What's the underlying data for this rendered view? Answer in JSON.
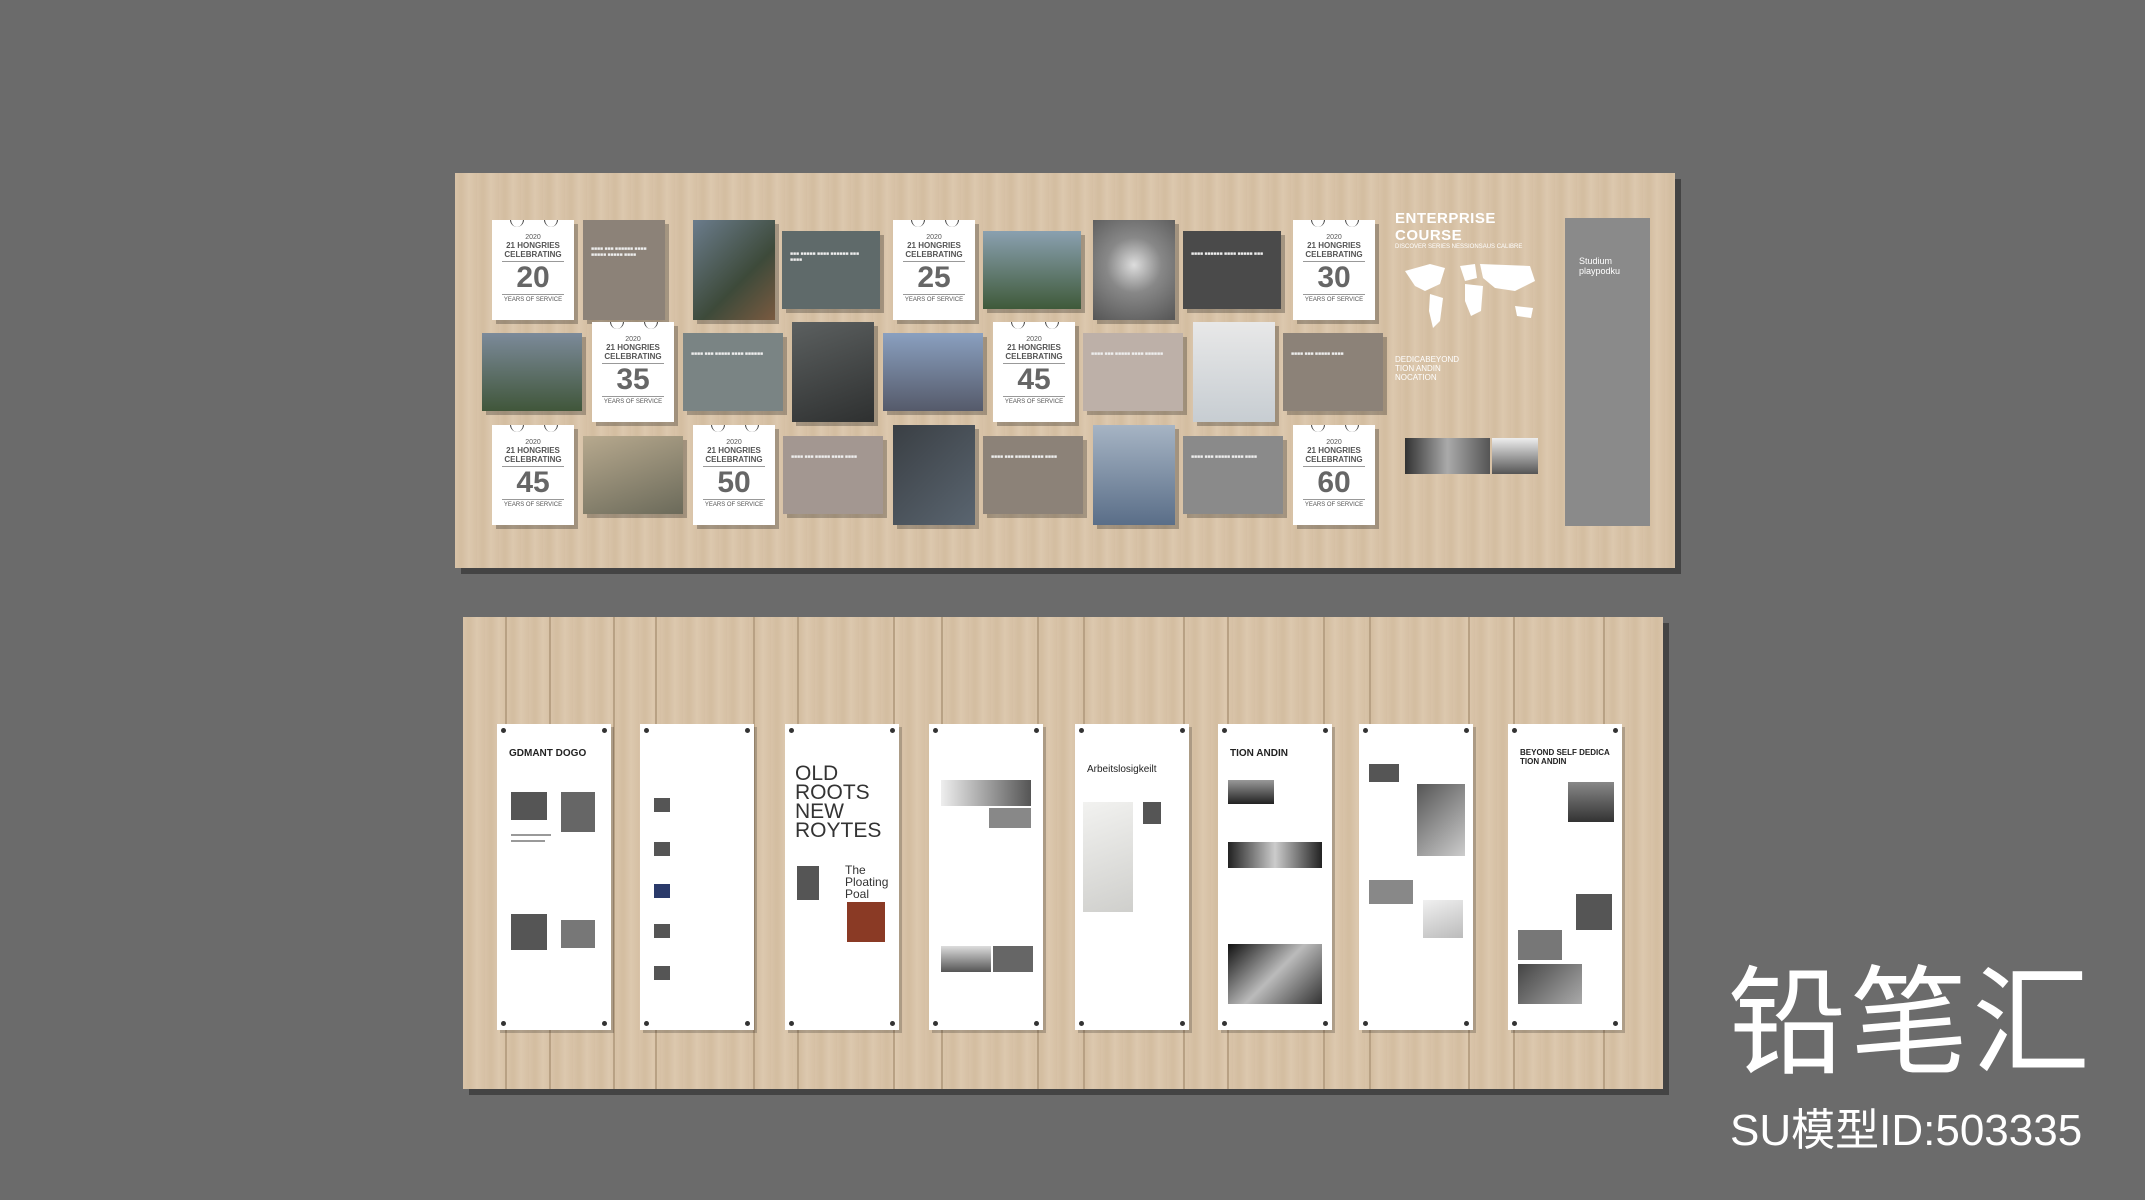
{
  "calendar_cards": [
    {
      "year": "2020",
      "line1": "21 HONGRIES",
      "line2": "CELEBRATING",
      "number": "20",
      "footer": "YEARS OF SERVICE"
    },
    {
      "year": "2020",
      "line1": "21 HONGRIES",
      "line2": "CELEBRATING",
      "number": "25",
      "footer": "YEARS OF SERVICE"
    },
    {
      "year": "2020",
      "line1": "21 HONGRIES",
      "line2": "CELEBRATING",
      "number": "30",
      "footer": "YEARS OF SERVICE"
    },
    {
      "year": "2020",
      "line1": "21 HONGRIES",
      "line2": "CELEBRATING",
      "number": "35",
      "footer": "YEARS OF SERVICE"
    },
    {
      "year": "2020",
      "line1": "21 HONGRIES",
      "line2": "CELEBRATING",
      "number": "45",
      "footer": "YEARS OF SERVICE"
    },
    {
      "year": "2020",
      "line1": "21 HONGRIES",
      "line2": "CELEBRATING",
      "number": "45",
      "footer": "YEARS OF SERVICE"
    },
    {
      "year": "2020",
      "line1": "21 HONGRIES",
      "line2": "CELEBRATING",
      "number": "50",
      "footer": "YEARS OF SERVICE"
    },
    {
      "year": "2020",
      "line1": "21 HONGRIES",
      "line2": "CELEBRATING",
      "number": "60",
      "footer": "YEARS OF SERVICE"
    }
  ],
  "map_panel": {
    "title": "ENTERPRISE COURSE",
    "subtitle": "DISCOVER SERIES NESSIONSAUS CALIBRE",
    "tagline_1": "DEDICABEYOND",
    "tagline_2": "TION ANDIN",
    "tagline_3": "NOCATION"
  },
  "side_panel": {
    "line1": "Studium",
    "line2": "playpodku"
  },
  "banners": {
    "b1_title": "GDMANT DOGO",
    "b3_big_1": "OLD",
    "b3_big_2": "ROOTS",
    "b3_big_3": "NEW",
    "b3_big_4": "ROYTES",
    "b3_sub_1": "The",
    "b3_sub_2": "Ploating",
    "b3_sub_3": "Poal",
    "b5_title": "Arbeitslosigkeilt",
    "b6_title": "TION ANDIN",
    "b8_title_1": "BEYOND SELF DEDICA",
    "b8_title_2": "TION ANDIN"
  },
  "watermark": {
    "brand_cn": "铅笔汇",
    "model_id": "SU模型ID:503335"
  },
  "colors": {
    "background": "#6b6b6b",
    "wood": "#d8c3a8",
    "dark_card": "#4a4a4a",
    "slate_card": "#5f6a6a",
    "taupe_card": "#8c8278",
    "side_panel": "#8a8a8a"
  }
}
